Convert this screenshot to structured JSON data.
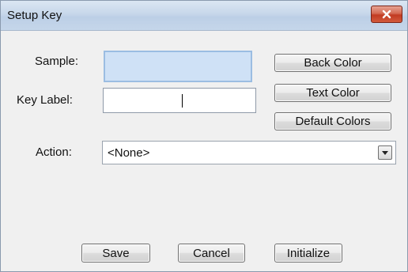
{
  "window": {
    "title": "Setup Key"
  },
  "sample": {
    "label": "Sample:",
    "color": "#cfe1f6"
  },
  "key_label": {
    "label": "Key Label:",
    "value": ""
  },
  "buttons": {
    "back_color": "Back Color",
    "text_color": "Text Color",
    "default_colors": "Default Colors",
    "save": "Save",
    "cancel": "Cancel",
    "initialize": "Initialize"
  },
  "action": {
    "label": "Action:",
    "selected": "<None>"
  },
  "icons": {
    "close": "close-icon",
    "dropdown": "chevron-down-icon"
  },
  "colors": {
    "close_button": "#c23b22",
    "titlebar": "#c7d7ea",
    "sample_swatch": "#cfe1f6"
  }
}
